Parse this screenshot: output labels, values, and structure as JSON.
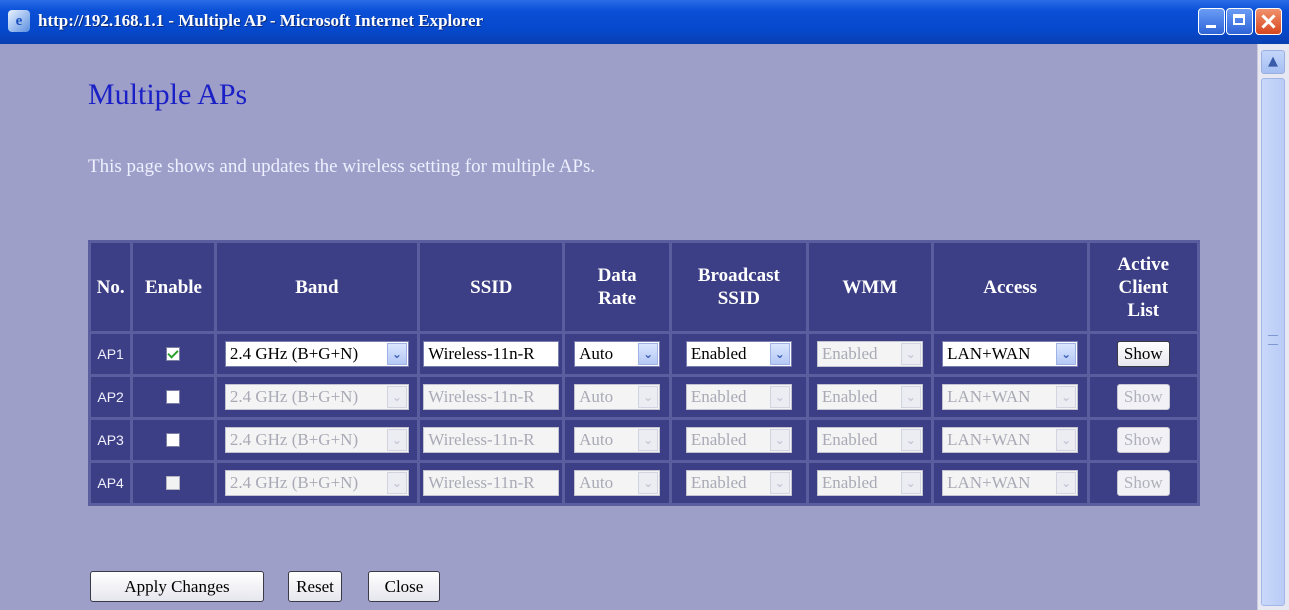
{
  "window": {
    "title": "http://192.168.1.1 - Multiple AP - Microsoft Internet Explorer"
  },
  "page": {
    "title": "Multiple APs",
    "description": "This page shows and updates the wireless setting for multiple APs."
  },
  "table": {
    "headers": {
      "no": "No.",
      "enable": "Enable",
      "band": "Band",
      "ssid": "SSID",
      "data_rate_1": "Data",
      "data_rate_2": "Rate",
      "broadcast_1": "Broadcast",
      "broadcast_2": "SSID",
      "wmm": "WMM",
      "access": "Access",
      "acl_1": "Active",
      "acl_2": "Client",
      "acl_3": "List"
    },
    "rows": [
      {
        "no": "AP1",
        "enabled": true,
        "band": "2.4 GHz (B+G+N)",
        "ssid": "Wireless-11n-R",
        "rate": "Auto",
        "broadcast": "Enabled",
        "wmm": "Enabled",
        "access": "LAN+WAN",
        "show": "Show"
      },
      {
        "no": "AP2",
        "enabled": false,
        "band": "2.4 GHz (B+G+N)",
        "ssid": "Wireless-11n-R",
        "rate": "Auto",
        "broadcast": "Enabled",
        "wmm": "Enabled",
        "access": "LAN+WAN",
        "show": "Show"
      },
      {
        "no": "AP3",
        "enabled": false,
        "band": "2.4 GHz (B+G+N)",
        "ssid": "Wireless-11n-R",
        "rate": "Auto",
        "broadcast": "Enabled",
        "wmm": "Enabled",
        "access": "LAN+WAN",
        "show": "Show"
      },
      {
        "no": "AP4",
        "enabled": false,
        "band": "2.4 GHz (B+G+N)",
        "ssid": "Wireless-11n-R",
        "rate": "Auto",
        "broadcast": "Enabled",
        "wmm": "Enabled",
        "access": "LAN+WAN",
        "show": "Show"
      }
    ]
  },
  "buttons": {
    "apply": "Apply Changes",
    "reset": "Reset",
    "close": "Close"
  },
  "icons": {
    "browser": "ie-icon",
    "dropdown": "chevron-down-icon",
    "check": "checkmark-icon"
  },
  "colors": {
    "page_bg": "#9d9fc9",
    "header_bg": "#3d3f86",
    "title_text": "#1a1fc6",
    "titlebar": "#0a4fd6"
  }
}
